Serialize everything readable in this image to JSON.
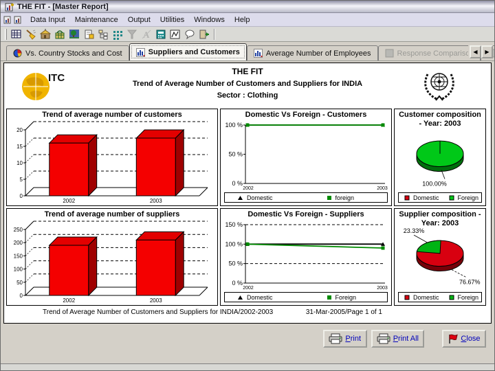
{
  "window": {
    "title": "THE FIT - [Master Report]"
  },
  "menu": {
    "items": [
      {
        "label": "Data Input"
      },
      {
        "label": "Maintenance"
      },
      {
        "label": "Output"
      },
      {
        "label": "Utilities"
      },
      {
        "label": "Windows"
      },
      {
        "label": "Help"
      }
    ]
  },
  "toolbar": {
    "icons": [
      "table-icon",
      "sweep-icon",
      "building-icon",
      "basket-icon",
      "tree-icon",
      "notes-icon",
      "hierarchy-icon",
      "grid-icon",
      "funnel-icon",
      "font-icon",
      "calculator-icon",
      "chart-icon",
      "comment-icon",
      "exit-icon"
    ]
  },
  "tabs": [
    {
      "label": "Vs. Country Stocks and Cost"
    },
    {
      "label": "Suppliers and Customers"
    },
    {
      "label": "Average Number of Employees"
    },
    {
      "label": "Response Comparison"
    }
  ],
  "header": {
    "logo_text": "ITC",
    "title": "THE FIT",
    "subtitle": "Trend of Average Number of Customers and Suppliers for INDIA",
    "sector_line": "Sector : Clothing"
  },
  "footer": {
    "left": "Trend of Average Number of Customers and Suppliers for INDIA/2002-2003",
    "right": "31-Mar-2005/Page 1 of 1"
  },
  "buttons": {
    "print": "Print",
    "print_all": "Print All",
    "close": "Close"
  },
  "colors": {
    "bar_red": "#f40000",
    "series_green": "#008a00",
    "pie_red": "#d80010",
    "pie_green": "#00c818",
    "button_text_blue": "#0000bb"
  },
  "chart_data": [
    {
      "type": "bar",
      "title": "Trend of average number of customers",
      "categories": [
        "2002",
        "2003"
      ],
      "values": [
        16,
        17.5
      ],
      "yticks": [
        0,
        5,
        10,
        15,
        20
      ],
      "ylim": [
        0,
        20
      ],
      "bar_color": "#f40000",
      "grid": "dashed-back-wall"
    },
    {
      "type": "line",
      "title": "Domestic Vs Foreign - Customers",
      "x": [
        "2002",
        "2003"
      ],
      "yticks": [
        0,
        50,
        100
      ],
      "tick_suffix": " %",
      "ylim": [
        0,
        100
      ],
      "gridlines": [],
      "legend_position": "bottom",
      "series": [
        {
          "name": "Domestic",
          "marker": "triangle",
          "color": "#000000",
          "values": [
            100,
            100
          ]
        },
        {
          "name": "foreign",
          "marker": "square",
          "color": "#008a00",
          "values": [
            100,
            100
          ]
        }
      ]
    },
    {
      "type": "pie",
      "title": "Customer composition - Year: 2003",
      "legend_position": "bottom",
      "slices": [
        {
          "name": "Domestic",
          "value": 0,
          "color": "#d80010",
          "label": ""
        },
        {
          "name": "Foreign",
          "value": 100,
          "color": "#00c818",
          "label": "100.00%"
        }
      ]
    },
    {
      "type": "bar",
      "title": "Trend of average number of suppliers",
      "categories": [
        "2002",
        "2003"
      ],
      "values": [
        190,
        210
      ],
      "yticks": [
        0,
        50,
        100,
        150,
        200,
        250
      ],
      "ylim": [
        0,
        250
      ],
      "bar_color": "#f40000",
      "grid": "dashed-back-wall"
    },
    {
      "type": "line",
      "title": "Domestic Vs Foreign - Suppliers",
      "x": [
        "2002",
        "2003"
      ],
      "yticks": [
        0,
        50,
        100,
        150
      ],
      "tick_suffix": " %",
      "ylim": [
        0,
        150
      ],
      "gridlines": [
        50,
        100,
        150
      ],
      "legend_position": "bottom",
      "series": [
        {
          "name": "Domestic",
          "marker": "triangle",
          "color": "#000000",
          "values": [
            100,
            100
          ]
        },
        {
          "name": "Foreign",
          "marker": "square",
          "color": "#008a00",
          "values": [
            100,
            90
          ]
        }
      ]
    },
    {
      "type": "pie",
      "title": "Supplier composition - Year: 2003",
      "legend_position": "bottom",
      "slices": [
        {
          "name": "Domestic",
          "value": 76.67,
          "color": "#d80010",
          "label": "76.67%"
        },
        {
          "name": "Foreign",
          "value": 23.33,
          "color": "#00b414",
          "label": "23.33%"
        }
      ]
    }
  ]
}
